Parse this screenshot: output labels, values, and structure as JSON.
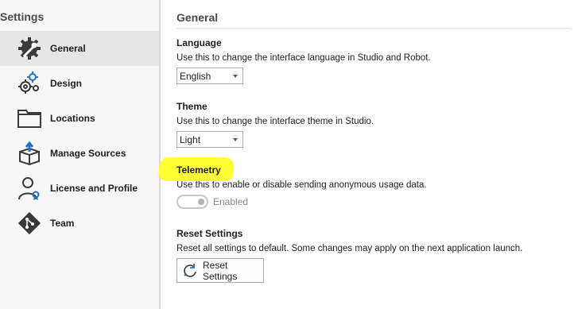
{
  "sidebar": {
    "title": "Settings",
    "items": [
      {
        "label": "General",
        "icon": "gear-wrench-icon",
        "active": true
      },
      {
        "label": "Design",
        "icon": "gears-icon",
        "active": false
      },
      {
        "label": "Locations",
        "icon": "folder-icon",
        "active": false
      },
      {
        "label": "Manage Sources",
        "icon": "package-upload-icon",
        "active": false
      },
      {
        "label": "License and Profile",
        "icon": "user-badge-icon",
        "active": false
      },
      {
        "label": "Team",
        "icon": "git-icon",
        "active": false
      }
    ]
  },
  "main": {
    "title": "General",
    "language": {
      "title": "Language",
      "description": "Use this to change the interface language in Studio and Robot.",
      "selected": "English"
    },
    "theme": {
      "title": "Theme",
      "description": "Use this to change the interface theme in Studio.",
      "selected": "Light"
    },
    "telemetry": {
      "title": "Telemetry",
      "description": "Use this to enable or disable sending anonymous usage data.",
      "toggle_label": "Enabled",
      "enabled": true
    },
    "reset": {
      "title": "Reset Settings",
      "description": "Reset all settings to default. Some changes may apply on the next application launch.",
      "button_label": "Reset Settings"
    }
  },
  "colors": {
    "highlight": "#ffff33",
    "accent_blue": "#1e73c8",
    "sidebar_bg": "#f7f7f7",
    "active_bg": "#e6e6e6"
  }
}
